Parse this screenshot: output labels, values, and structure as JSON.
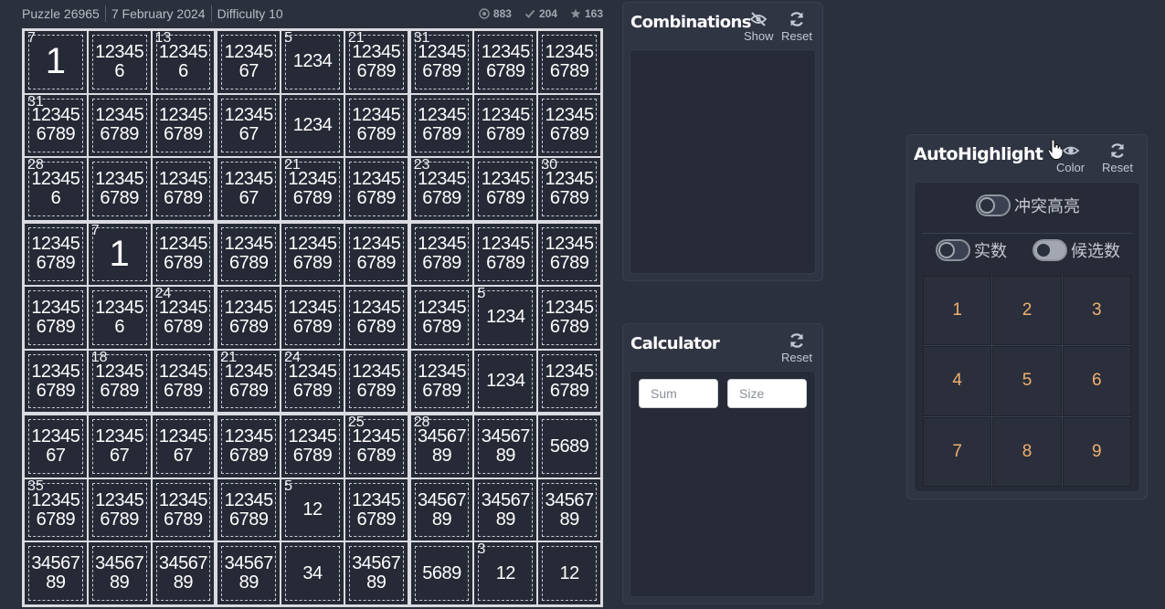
{
  "header": {
    "puzzle": "Puzzle 26965",
    "date": "7 February 2024",
    "difficulty": "Difficulty 10",
    "stats": [
      {
        "icon": "eye-circle-icon",
        "value": "883"
      },
      {
        "icon": "check-icon",
        "value": "204"
      },
      {
        "icon": "star-icon",
        "value": "163"
      }
    ]
  },
  "grid": {
    "rows": [
      [
        {
          "v": "1",
          "s": "7"
        },
        {
          "c": "12345\n6"
        },
        {
          "c": "12345\n6",
          "s": "13"
        },
        {
          "c": "12345\n67"
        },
        {
          "c": "1234",
          "s": "5"
        },
        {
          "c": "12345\n6789",
          "s": "21"
        },
        {
          "c": "12345\n6789",
          "s": "31"
        },
        {
          "c": "12345\n6789"
        },
        {
          "c": "12345\n6789"
        }
      ],
      [
        {
          "c": "12345\n6789",
          "s": "31"
        },
        {
          "c": "12345\n6789"
        },
        {
          "c": "12345\n6789"
        },
        {
          "c": "12345\n67"
        },
        {
          "c": "1234"
        },
        {
          "c": "12345\n6789"
        },
        {
          "c": "12345\n6789"
        },
        {
          "c": "12345\n6789"
        },
        {
          "c": "12345\n6789"
        }
      ],
      [
        {
          "c": "12345\n6",
          "s": "28"
        },
        {
          "c": "12345\n6789"
        },
        {
          "c": "12345\n6789"
        },
        {
          "c": "12345\n67"
        },
        {
          "c": "12345\n6789",
          "s": "21"
        },
        {
          "c": "12345\n6789"
        },
        {
          "c": "12345\n6789",
          "s": "23"
        },
        {
          "c": "12345\n6789"
        },
        {
          "c": "12345\n6789",
          "s": "30"
        }
      ],
      [
        {
          "c": "12345\n6789"
        },
        {
          "v": "1",
          "s": "7"
        },
        {
          "c": "12345\n6789"
        },
        {
          "c": "12345\n6789"
        },
        {
          "c": "12345\n6789"
        },
        {
          "c": "12345\n6789"
        },
        {
          "c": "12345\n6789"
        },
        {
          "c": "12345\n6789"
        },
        {
          "c": "12345\n6789"
        }
      ],
      [
        {
          "c": "12345\n6789"
        },
        {
          "c": "12345\n6"
        },
        {
          "c": "12345\n6789",
          "s": "24"
        },
        {
          "c": "12345\n6789"
        },
        {
          "c": "12345\n6789"
        },
        {
          "c": "12345\n6789"
        },
        {
          "c": "12345\n6789"
        },
        {
          "c": "1234",
          "s": "5"
        },
        {
          "c": "12345\n6789"
        }
      ],
      [
        {
          "c": "12345\n6789"
        },
        {
          "c": "12345\n6789",
          "s": "18"
        },
        {
          "c": "12345\n6789"
        },
        {
          "c": "12345\n6789",
          "s": "21"
        },
        {
          "c": "12345\n6789",
          "s": "24"
        },
        {
          "c": "12345\n6789"
        },
        {
          "c": "12345\n6789"
        },
        {
          "c": "1234"
        },
        {
          "c": "12345\n6789"
        }
      ],
      [
        {
          "c": "12345\n67"
        },
        {
          "c": "12345\n67"
        },
        {
          "c": "12345\n67"
        },
        {
          "c": "12345\n6789"
        },
        {
          "c": "12345\n6789"
        },
        {
          "c": "12345\n6789",
          "s": "25"
        },
        {
          "c": "34567\n89",
          "s": "28"
        },
        {
          "c": "34567\n89"
        },
        {
          "c": "5689"
        }
      ],
      [
        {
          "c": "12345\n6789",
          "s": "35"
        },
        {
          "c": "12345\n6789"
        },
        {
          "c": "12345\n6789"
        },
        {
          "c": "12345\n6789"
        },
        {
          "c": "12",
          "s": "5"
        },
        {
          "c": "12345\n6789"
        },
        {
          "c": "34567\n89"
        },
        {
          "c": "34567\n89"
        },
        {
          "c": "34567\n89"
        }
      ],
      [
        {
          "c": "34567\n89"
        },
        {
          "c": "34567\n89"
        },
        {
          "c": "34567\n89"
        },
        {
          "c": "34567\n89"
        },
        {
          "c": "34"
        },
        {
          "c": "34567\n89"
        },
        {
          "c": "5689"
        },
        {
          "c": "12",
          "s": "3"
        },
        {
          "c": "12"
        }
      ]
    ]
  },
  "combinations": {
    "title": "Combinations",
    "show_label": "Show",
    "reset_label": "Reset"
  },
  "calculator": {
    "title": "Calculator",
    "reset_label": "Reset",
    "sum_placeholder": "Sum",
    "size_placeholder": "Size"
  },
  "autohighlight": {
    "title": "AutoHighlight",
    "color_label": "Color",
    "reset_label": "Reset",
    "conflict_label": "冲突高亮",
    "real_label": "实数",
    "candidate_label": "候选数",
    "digits": [
      "1",
      "2",
      "3",
      "4",
      "5",
      "6",
      "7",
      "8",
      "9"
    ]
  },
  "colors": {
    "background": "#2b303d",
    "cell": "#252a36",
    "digit_accent": "#f0b070"
  }
}
